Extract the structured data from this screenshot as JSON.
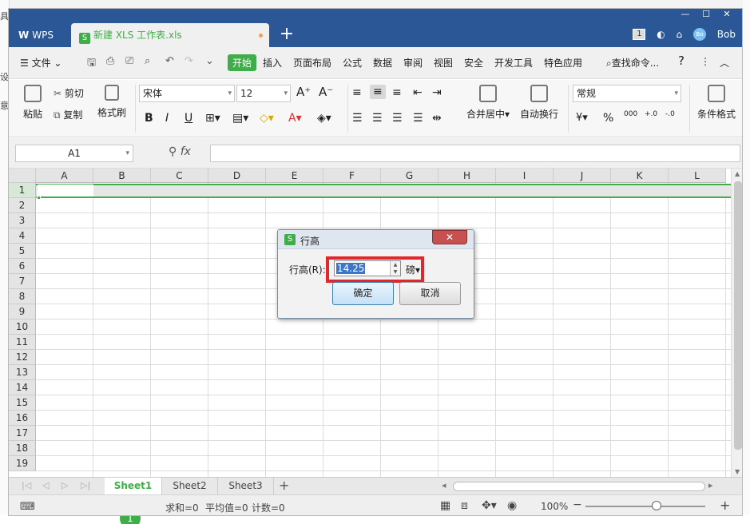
{
  "app": {
    "home_tab": "WPS",
    "doc_tab": "新建 XLS 工作表.xls",
    "window_count": "1",
    "user": "Bob",
    "avatar_text": "Bo"
  },
  "menu": {
    "file": "文件",
    "items": [
      "开始",
      "插入",
      "页面布局",
      "公式",
      "数据",
      "审阅",
      "视图",
      "安全",
      "开发工具",
      "特色应用"
    ],
    "search": "查找命令...",
    "help": "?"
  },
  "ribbon": {
    "paste": "粘贴",
    "cut": "剪切",
    "copy": "复制",
    "format_painter": "格式刷",
    "font_name": "宋体",
    "font_size": "12",
    "merge_center": "合并居中",
    "wrap_text": "自动换行",
    "number_format": "常规",
    "conditional_format": "条件格式"
  },
  "formula_bar": {
    "name_box": "A1",
    "fx": "fx"
  },
  "sheet": {
    "columns": [
      "A",
      "B",
      "C",
      "D",
      "E",
      "F",
      "G",
      "H",
      "I",
      "J",
      "K",
      "L"
    ],
    "rows": [
      "1",
      "2",
      "3",
      "4",
      "5",
      "6",
      "7",
      "8",
      "9",
      "10",
      "11",
      "12",
      "13",
      "14",
      "15",
      "16",
      "17",
      "18",
      "19"
    ]
  },
  "sheet_tabs": [
    "Sheet1",
    "Sheet2",
    "Sheet3"
  ],
  "status": {
    "sum": "求和=0",
    "avg": "平均值=0",
    "count": "计数=0",
    "zoom": "100%"
  },
  "dialog": {
    "title": "行高",
    "label": "行高(R):",
    "value": "14.25",
    "unit": "磅",
    "ok": "确定",
    "cancel": "取消"
  },
  "colors": {
    "accent": "#3fae49",
    "titlebar": "#2b5797",
    "highlight_box": "#e0272b"
  }
}
